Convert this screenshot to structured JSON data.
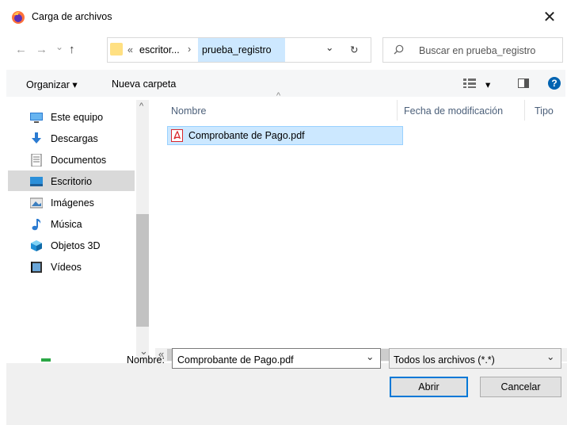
{
  "window": {
    "title": "Carga de archivos",
    "close_glyph": "✕"
  },
  "nav": {
    "back": "←",
    "forward": "→",
    "recent": "⌄",
    "up": "↑"
  },
  "address": {
    "overflow": "«",
    "crumbs": [
      "escritor...",
      "prueba_registro"
    ],
    "separator": "›",
    "dropdown": "⌄",
    "refresh": "↻"
  },
  "search": {
    "placeholder": "Buscar en prueba_registro"
  },
  "toolbar": {
    "organize": "Organizar ▾",
    "new_folder": "Nueva carpeta",
    "view_arrow": "▾",
    "help": "?"
  },
  "sidebar": {
    "items": [
      {
        "label": "Este equipo",
        "icon": "computer-icon"
      },
      {
        "label": "Descargas",
        "icon": "download-icon"
      },
      {
        "label": "Documentos",
        "icon": "document-icon"
      },
      {
        "label": "Escritorio",
        "icon": "desktop-icon",
        "selected": true
      },
      {
        "label": "Imágenes",
        "icon": "pictures-icon"
      },
      {
        "label": "Música",
        "icon": "music-icon"
      },
      {
        "label": "Objetos 3D",
        "icon": "cube-icon"
      },
      {
        "label": "Vídeos",
        "icon": "video-icon"
      }
    ]
  },
  "columns": {
    "name": "Nombre",
    "modified": "Fecha de modificación",
    "type": "Tipo",
    "sort_glyph": "^"
  },
  "files": [
    {
      "name": "Comprobante de Pago.pdf",
      "icon": "pdf-icon",
      "selected": true
    }
  ],
  "bottom": {
    "name_label": "Nombre:",
    "file_name": "Comprobante de Pago.pdf",
    "filter": "Todos los archivos (*.*)",
    "open": "Abrir",
    "cancel": "Cancelar"
  },
  "colors": {
    "selection": "#cce8ff",
    "selection_border": "#99d1ff",
    "accent": "#0078d7",
    "help": "#0063b1"
  }
}
